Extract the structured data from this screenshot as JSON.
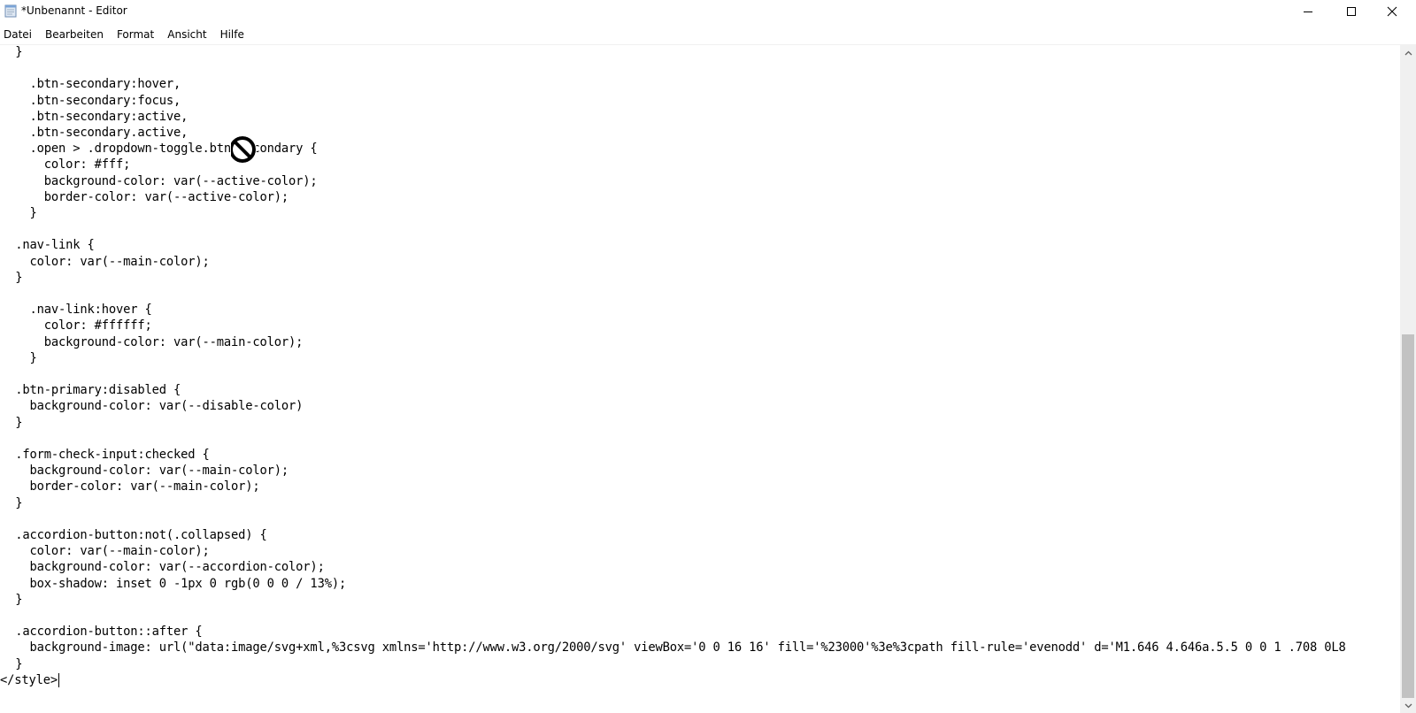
{
  "window": {
    "title": "*Unbenannt - Editor",
    "icons": {
      "app": "notepad-icon",
      "minimize": "minimize-icon",
      "maximize": "maximize-icon",
      "close": "close-icon"
    }
  },
  "menu": {
    "items": [
      "Datei",
      "Bearbeiten",
      "Format",
      "Ansicht",
      "Hilfe"
    ]
  },
  "editor": {
    "lines": [
      "  }",
      "",
      "    .btn-secondary:hover,",
      "    .btn-secondary:focus,",
      "    .btn-secondary:active,",
      "    .btn-secondary.active,",
      "    .open > .dropdown-toggle.btn-secondary {",
      "      color: #fff;",
      "      background-color: var(--active-color);",
      "      border-color: var(--active-color);",
      "    }",
      "",
      "  .nav-link {",
      "    color: var(--main-color);",
      "  }",
      "",
      "    .nav-link:hover {",
      "      color: #ffffff;",
      "      background-color: var(--main-color);",
      "    }",
      "",
      "  .btn-primary:disabled {",
      "    background-color: var(--disable-color)",
      "  }",
      "",
      "  .form-check-input:checked {",
      "    background-color: var(--main-color);",
      "    border-color: var(--main-color);",
      "  }",
      "",
      "  .accordion-button:not(.collapsed) {",
      "    color: var(--main-color);",
      "    background-color: var(--accordion-color);",
      "    box-shadow: inset 0 -1px 0 rgb(0 0 0 / 13%);",
      "  }",
      "",
      "  .accordion-button::after {",
      "    background-image: url(\"data:image/svg+xml,%3csvg xmlns='http://www.w3.org/2000/svg' viewBox='0 0 16 16' fill='%23000'%3e%3cpath fill-rule='evenodd' d='M1.646 4.646a.5.5 0 0 1 .708 0L8",
      "  }",
      "</style>"
    ],
    "cursor_icon": "not-allowed-cursor-icon"
  },
  "scrollbar": {
    "position_fraction": 0.43,
    "visible_fraction": 0.57
  }
}
